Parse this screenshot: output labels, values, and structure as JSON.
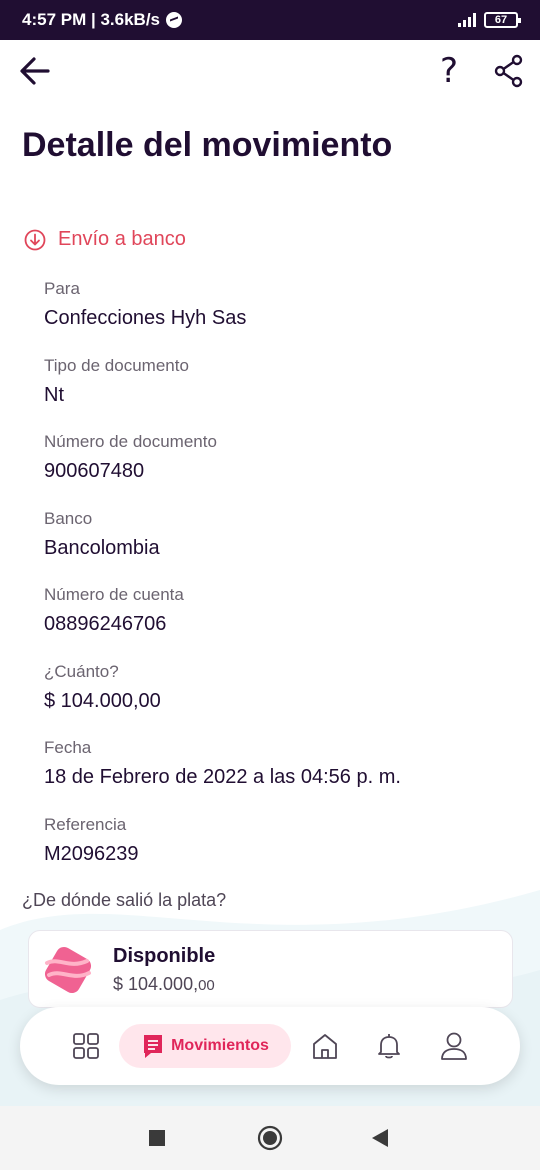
{
  "status_bar": {
    "time_speed": "4:57 PM | 3.6kB/s",
    "battery": "67"
  },
  "header": {
    "help_glyph": "?",
    "title": "Detalle del movimiento"
  },
  "transaction": {
    "type_label": "Envío a banco",
    "fields": [
      {
        "label": "Para",
        "value": "Confecciones Hyh Sas"
      },
      {
        "label": "Tipo de documento",
        "value": "Nt"
      },
      {
        "label": "Número de documento",
        "value": "900607480"
      },
      {
        "label": "Banco",
        "value": "Bancolombia"
      },
      {
        "label": "Número de cuenta",
        "value": "08896246706"
      },
      {
        "label": "¿Cuánto?",
        "value": "$ 104.000,00"
      },
      {
        "label": "Fecha",
        "value": "18 de Febrero de 2022 a las 04:56 p. m."
      },
      {
        "label": "Referencia",
        "value": "M2096239"
      }
    ]
  },
  "source": {
    "question": "¿De dónde salió la plata?",
    "pocket_name": "Disponible",
    "pocket_amount_main": "$ 104.000,",
    "pocket_amount_cents": "00"
  },
  "bottom_nav": {
    "active_label": "Movimientos",
    "items": [
      "grid-icon",
      "movements-icon",
      "home-icon",
      "bell-icon",
      "profile-icon"
    ]
  },
  "colors": {
    "primary": "#200e32",
    "accent": "#e0465a",
    "active_pill": "#ffe6ec"
  }
}
